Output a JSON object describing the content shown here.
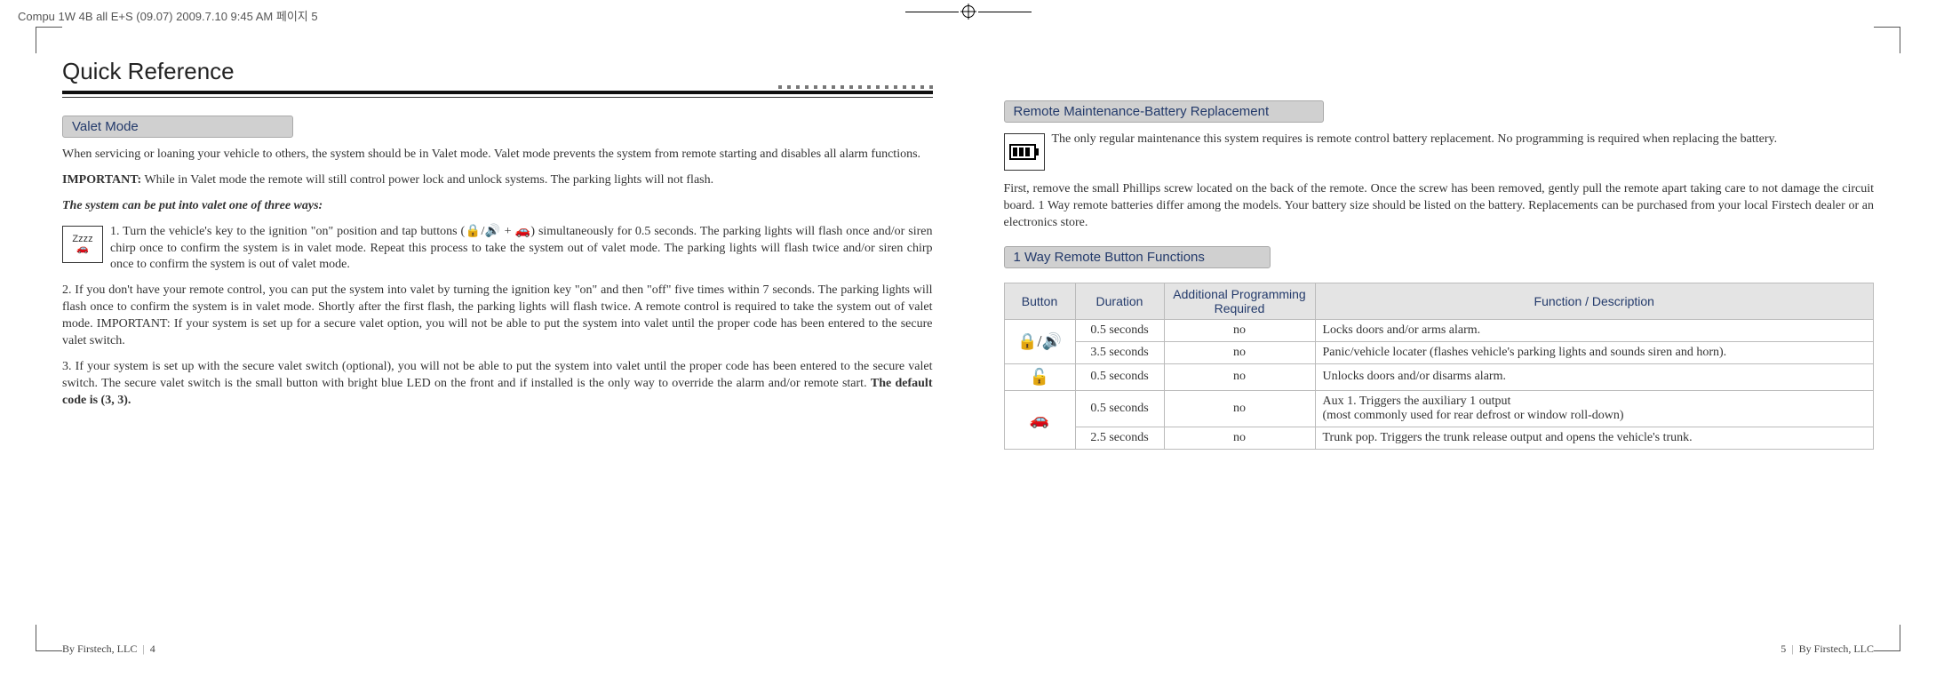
{
  "print_header": "Compu 1W 4B all E+S (09.07)  2009.7.10 9:45 AM  페이지 5",
  "page_title": "Quick Reference",
  "left": {
    "section_title": "Valet Mode",
    "p1": "When servicing or loaning your vehicle to others, the system should be in Valet mode.  Valet mode prevents the system from remote starting and disables all alarm functions.",
    "important_label": "IMPORTANT:",
    "important_text": "While in Valet mode the remote will still control power lock and unlock systems. The parking lights will not flash.",
    "subhead": "The system can be put into valet one of three ways:",
    "step1": "1.  Turn the vehicle's  key to the ignition \"on\" position and tap buttons   (🔒/🔊 + 🚗)    simultaneously for 0.5 seconds. The parking lights will flash once and/or siren chirp once to confirm the system is in valet mode. Repeat this process to take the system out of valet mode. The parking lights will flash twice and/or siren chirp once to confirm the system is out of valet mode.",
    "step2": "2.   If you don't have your remote control, you can put the system into valet by turning the ignition key \"on\" and then \"off\" five times within 7 seconds. The parking lights will flash once to confirm the system is in valet mode.  Shortly after the first flash, the parking lights will flash twice. A remote control is required to take the system out of valet mode. IMPORTANT:  If your system is set up for a secure valet option, you will not be able to put the system into valet until the proper code has been entered to the secure valet switch.",
    "step3a": "3.   If your system is set up with the secure valet switch (optional), you will not be able to put the system into valet until the proper code has been entered to the secure valet switch. The secure valet switch is the small button with bright blue LED on the front and if installed is the only way to override the alarm and/or remote start. ",
    "step3b": "The default code is (3, 3).",
    "zz_icon": "Zzzz",
    "footer_by": "By Firstech, LLC",
    "footer_page": "4"
  },
  "right": {
    "section1_title": "Remote Maintenance-Battery Replacement",
    "batt_text": "The only regular maintenance this system requires is remote control battery replacement. No programming is required when replacing the battery.",
    "batt_p2": "First, remove the small Phillips screw located on the back of the remote. Once the screw has been removed, gently pull the remote apart taking care to not damage the circuit board. 1 Way remote batteries differ among the models. Your battery size should be listed on the battery. Replacements can be purchased from your local Firstech dealer or an electronics store.",
    "section2_title": "1 Way Remote Button Functions",
    "table": {
      "headers": [
        "Button",
        "Duration",
        "Additional Programming Required",
        "Function / Description"
      ],
      "rows": [
        {
          "icon": "🔒/🔊",
          "duration": "0.5 seconds",
          "prog": "no",
          "desc": "Locks doors and/or arms alarm."
        },
        {
          "icon": "",
          "duration": "3.5 seconds",
          "prog": "no",
          "desc": "Panic/vehicle locater (flashes vehicle's parking lights and sounds siren and horn)."
        },
        {
          "icon": "🔓",
          "duration": "0.5 seconds",
          "prog": "no",
          "desc": "Unlocks doors and/or disarms alarm."
        },
        {
          "icon": "🚗",
          "duration": "0.5 seconds",
          "prog": "no",
          "desc": "Aux 1. Triggers the auxiliary 1 output\n (most commonly used for rear defrost or window roll-down)"
        },
        {
          "icon": "",
          "duration": "2.5 seconds",
          "prog": "no",
          "desc": "Trunk pop. Triggers the trunk release output and opens the vehicle's trunk."
        }
      ]
    },
    "footer_by": "By Firstech, LLC",
    "footer_page": "5"
  }
}
